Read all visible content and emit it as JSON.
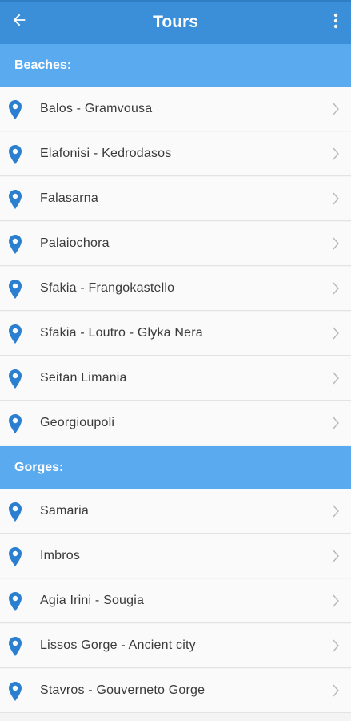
{
  "appbar": {
    "title": "Tours"
  },
  "icons": {
    "back": "arrow-back-icon",
    "menu": "more-vert-icon",
    "location": "location-pin-icon",
    "chevron": "chevron-right-icon"
  },
  "colors": {
    "appbar": "#3a8fd8",
    "section": "#5aaaf0",
    "pin": "#2a7fd0"
  },
  "sections": [
    {
      "label": "Beaches:",
      "items": [
        "Balos - Gramvousa",
        "Elafonisi - Kedrodasos",
        "Falasarna",
        "Palaiochora",
        "Sfakia - Frangokastello",
        "Sfakia - Loutro - Glyka Nera",
        "Seitan Limania",
        "Georgioupoli"
      ]
    },
    {
      "label": "Gorges:",
      "items": [
        "Samaria",
        "Imbros",
        "Agia Irini - Sougia",
        "Lissos Gorge - Ancient city",
        "Stavros - Gouverneto Gorge"
      ]
    }
  ]
}
